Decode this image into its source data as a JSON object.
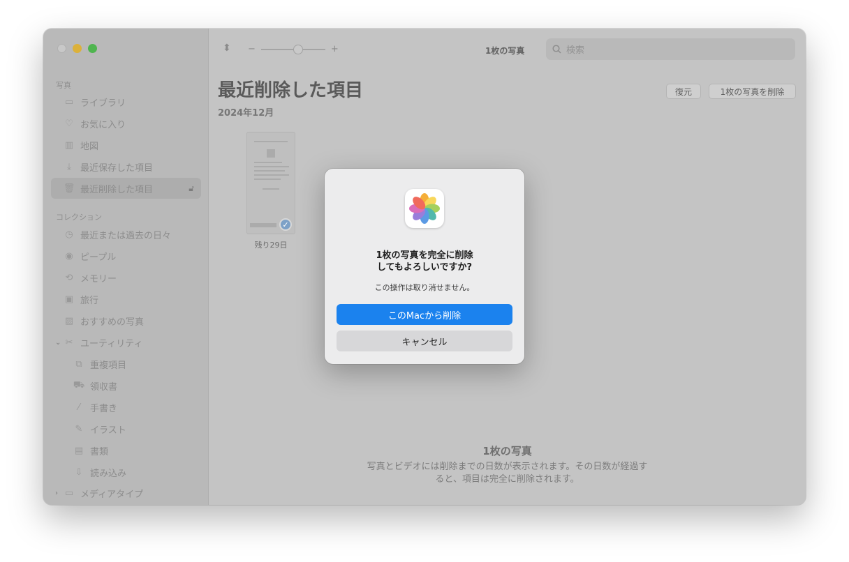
{
  "sidebar": {
    "photos_section": "写真",
    "items": [
      {
        "label": "ライブラリ",
        "icon": "library-icon"
      },
      {
        "label": "お気に入り",
        "icon": "heart-icon"
      },
      {
        "label": "地図",
        "icon": "map-icon"
      },
      {
        "label": "最近保存した項目",
        "icon": "download-icon"
      },
      {
        "label": "最近削除した項目",
        "icon": "trash-icon",
        "selected": true,
        "locked": true
      }
    ],
    "collections_section": "コレクション",
    "collections": [
      {
        "label": "最近または過去の日々",
        "icon": "clock-icon"
      },
      {
        "label": "ピープル",
        "icon": "person-icon"
      },
      {
        "label": "メモリー",
        "icon": "memories-icon"
      },
      {
        "label": "旅行",
        "icon": "suitcase-icon"
      },
      {
        "label": "おすすめの写真",
        "icon": "photo-icon"
      },
      {
        "label": "ユーティリティ",
        "icon": "tools-icon",
        "expanded": true
      }
    ],
    "utilities": [
      {
        "label": "重複項目",
        "icon": "duplicate-icon"
      },
      {
        "label": "領収書",
        "icon": "cart-icon"
      },
      {
        "label": "手書き",
        "icon": "pen-icon"
      },
      {
        "label": "イラスト",
        "icon": "brush-icon"
      },
      {
        "label": "書類",
        "icon": "document-icon"
      },
      {
        "label": "読み込み",
        "icon": "import-icon"
      }
    ],
    "media_types": {
      "label": "メディアタイプ",
      "icon": "folder-icon",
      "expanded": false
    }
  },
  "toolbar": {
    "zoom_minus": "−",
    "zoom_plus": "+",
    "zoom_level": 0.5,
    "photo_count": "1枚の写真",
    "search_placeholder": "検索"
  },
  "main": {
    "title": "最近削除した項目",
    "date": "2024年12月",
    "restore_label": "復元",
    "delete_all_label": "1枚の写真を削除",
    "thumbnail_days_left": "残り29日",
    "footer_title": "1枚の写真",
    "footer_text_line1": "写真とビデオには削除までの日数が表示されます。その日数が経過す",
    "footer_text_line2": "ると、項目は完全に削除されます。"
  },
  "dialog": {
    "title_line1": "1枚の写真を完全に削除",
    "title_line2": "してもよろしいですか?",
    "message": "この操作は取り消せません。",
    "primary_label": "このMacから削除",
    "cancel_label": "キャンセル",
    "primary_color": "#1b82ee"
  }
}
